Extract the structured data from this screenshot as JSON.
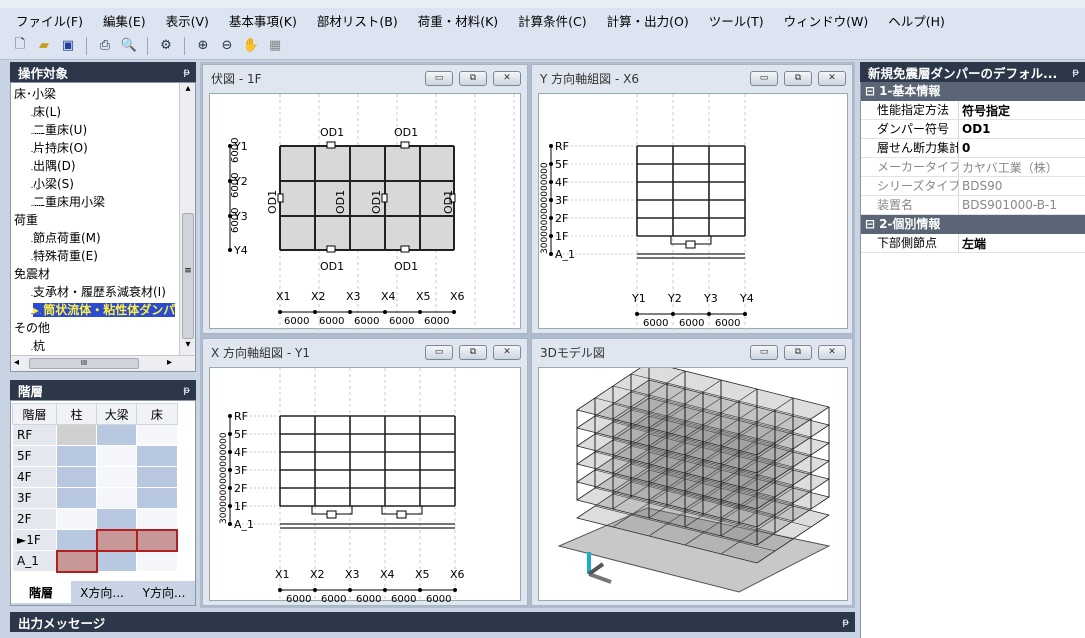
{
  "menu": [
    "ファイル(F)",
    "編集(E)",
    "表示(V)",
    "基本事項(K)",
    "部材リスト(B)",
    "荷重・材料(K)",
    "計算条件(C)",
    "計算・出力(O)",
    "ツール(T)",
    "ウィンドウ(W)",
    "ヘルプ(H)"
  ],
  "toolbar_icons": [
    "new-file-icon",
    "open-folder-icon",
    "save-icon",
    "print-icon",
    "print-preview-icon",
    "settings-icon",
    "zoom-in-icon",
    "zoom-out-icon",
    "pan-hand-icon",
    "grid-icon"
  ],
  "target_panel": {
    "title": "操作対象",
    "pin": "ᵽ",
    "items": [
      {
        "label": "床･小梁",
        "level": 1
      },
      {
        "label": "床(L)",
        "level": 2
      },
      {
        "label": "二重床(U)",
        "level": 2
      },
      {
        "label": "片持床(O)",
        "level": 2
      },
      {
        "label": "出隅(D)",
        "level": 2
      },
      {
        "label": "小梁(S)",
        "level": 2
      },
      {
        "label": "二重床用小梁",
        "level": 2
      },
      {
        "label": "荷重",
        "level": 1
      },
      {
        "label": "節点荷重(M)",
        "level": 2
      },
      {
        "label": "特殊荷重(E)",
        "level": 2
      },
      {
        "label": "免震材",
        "level": 1
      },
      {
        "label": "支承材・履歴系減衰材(I)",
        "level": 2
      },
      {
        "label": "▸ 筒状流体・粘性体ダンパ",
        "level": 2,
        "selected": true
      },
      {
        "label": "その他",
        "level": 1
      },
      {
        "label": "杭",
        "level": 2
      }
    ],
    "scroll_left": "◂",
    "scroll_right": "▸",
    "scroll_grip": "III",
    "scroll_up": "▴",
    "scroll_down": "▾",
    "scroll_mid": "≡"
  },
  "floor_panel": {
    "title": "階層",
    "pin": "ᵽ",
    "headers": [
      "階層",
      "柱",
      "大梁",
      "床"
    ],
    "rows": [
      {
        "floor": "RF",
        "cells": [
          "gray",
          "blue",
          "white"
        ]
      },
      {
        "floor": "5F",
        "cells": [
          "blue",
          "white",
          "blue"
        ]
      },
      {
        "floor": "4F",
        "cells": [
          "blue",
          "white",
          "blue"
        ]
      },
      {
        "floor": "3F",
        "cells": [
          "blue",
          "white",
          "blue"
        ]
      },
      {
        "floor": "2F",
        "cells": [
          "white",
          "blue",
          "white"
        ]
      },
      {
        "floor": "►1F",
        "cells": [
          "blue",
          "red",
          "red"
        ]
      },
      {
        "floor": "A_1",
        "cells": [
          "red",
          "blue",
          "white"
        ]
      }
    ],
    "tabs": [
      "階層",
      "X方向...",
      "Y方向..."
    ]
  },
  "colors": {
    "blue": "#b8c8e0",
    "white": "#f4f6fa",
    "gray": "#d0d0d0",
    "red": "#c89898",
    "red_border": "#b02020"
  },
  "windows": {
    "plan": {
      "title": "伏図 - 1F",
      "y_labels": [
        "Y4",
        "Y3",
        "Y2",
        "Y1"
      ],
      "x_labels": [
        "X1",
        "X2",
        "X3",
        "X4",
        "X5",
        "X6"
      ],
      "spans_y": [
        "6000",
        "6000",
        "6000"
      ],
      "spans_x": [
        "6000",
        "6000",
        "6000",
        "6000",
        "6000"
      ],
      "damper_label": "OD1"
    },
    "yframe": {
      "title": "Y 方向軸組図 - X6",
      "levels": [
        "RF",
        "5F",
        "4F",
        "3F",
        "2F",
        "1F",
        "A_1"
      ],
      "x_labels": [
        "Y1",
        "Y2",
        "Y3",
        "Y4"
      ],
      "spans": [
        "6000",
        "6000",
        "6000"
      ],
      "height_dim": "3000000000000000"
    },
    "xframe": {
      "title": "X 方向軸組図 - Y1",
      "levels": [
        "RF",
        "5F",
        "4F",
        "3F",
        "2F",
        "1F",
        "A_1"
      ],
      "x_labels": [
        "X1",
        "X2",
        "X3",
        "X4",
        "X5",
        "X6"
      ],
      "spans": [
        "6000",
        "6000",
        "6000",
        "6000",
        "6000"
      ],
      "height_dim": "3000000000000000"
    },
    "model3d": {
      "title": "3Dモデル図"
    }
  },
  "window_buttons": {
    "minimize": "▭",
    "restore": "⧉",
    "close": "✕"
  },
  "props": {
    "title": "新規免震層ダンパーのデフォル...",
    "pin": "ᵽ",
    "groups": [
      {
        "name": "1-基本情報",
        "toggle": "⊟",
        "rows": [
          {
            "label": "性能指定方法",
            "value": "符号指定",
            "bold": true
          },
          {
            "label": "ダンパー符号",
            "value": "OD1",
            "bold": true
          },
          {
            "label": "層せん断力集計",
            "value": "0",
            "bold": true
          },
          {
            "label": "メーカータイプ",
            "value": "カヤバ工業（株）",
            "dim": true
          },
          {
            "label": "シリーズタイプ名",
            "value": "BDS90",
            "dim": true
          },
          {
            "label": "装置名",
            "value": "BDS901000-B-1",
            "dim": true
          }
        ]
      },
      {
        "name": "2-個別情報",
        "toggle": "⊟",
        "rows": [
          {
            "label": "下部側節点",
            "value": "左端",
            "bold": true
          }
        ]
      }
    ]
  },
  "output": {
    "title": "出力メッセージ",
    "pin": "ᵽ"
  }
}
